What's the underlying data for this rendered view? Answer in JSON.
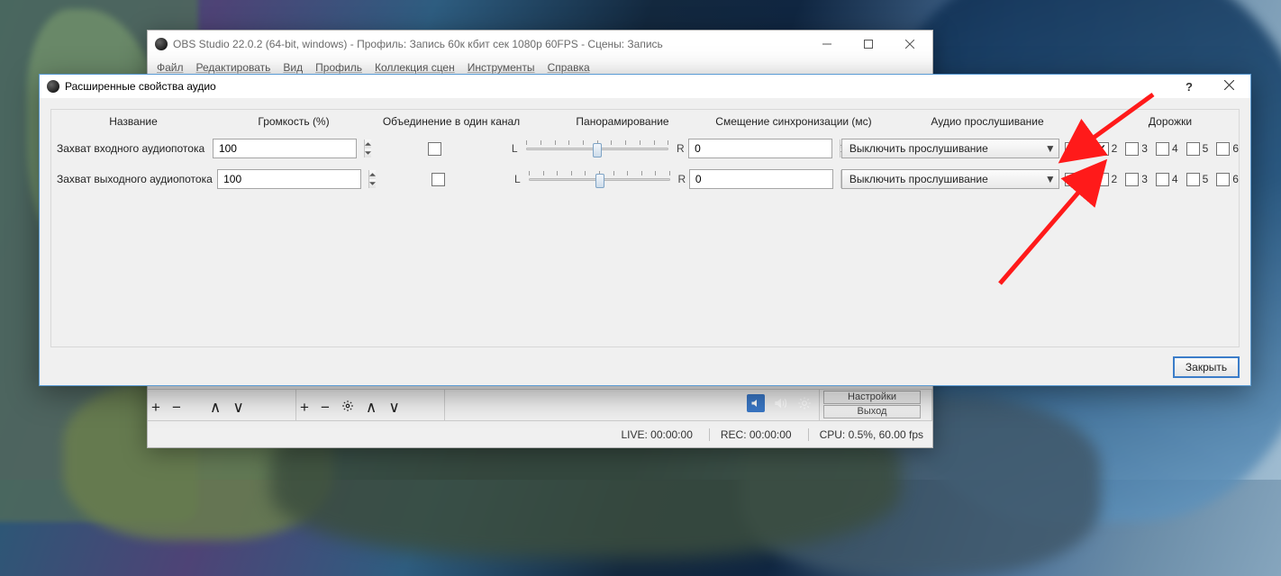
{
  "obs": {
    "title": "OBS Studio 22.0.2 (64-bit, windows) - Профиль: Запись 60к кбит сек 1080p 60FPS - Сцены: Запись",
    "menu": {
      "file": "Файл",
      "edit": "Редактировать",
      "view": "Вид",
      "profile": "Профиль",
      "sceneCollection": "Коллекция сцен",
      "tools": "Инструменты",
      "help": "Справка"
    },
    "status": {
      "live": "LIVE: 00:00:00",
      "rec": "REC: 00:00:00",
      "cpu": "CPU: 0.5%, 60.00 fps"
    },
    "controls": {
      "hiddenTop": "Настройки",
      "exit": "Выход"
    }
  },
  "dialog": {
    "title": "Расширенные свойства аудио",
    "closeBtn": "Закрыть",
    "headers": {
      "name": "Название",
      "volume": "Громкость (%)",
      "mono": "Объединение в один канал",
      "pan": "Панорамирование",
      "sync": "Смещение синхронизации (мс)",
      "monitor": "Аудио прослушивание",
      "tracks": "Дорожки"
    },
    "panLabels": {
      "l": "L",
      "r": "R"
    },
    "trackLabels": [
      "1",
      "2",
      "3",
      "4",
      "5",
      "6"
    ],
    "rows": [
      {
        "name": "Захват входного аудиопотока",
        "volume": "100",
        "mono": false,
        "sync": "0",
        "monitor": "Выключить прослушивание",
        "tracks": [
          false,
          true,
          false,
          false,
          false,
          false
        ]
      },
      {
        "name": "Захват выходного аудиопотока",
        "volume": "100",
        "mono": false,
        "sync": "0",
        "monitor": "Выключить прослушивание",
        "tracks": [
          true,
          false,
          false,
          false,
          false,
          false
        ]
      }
    ]
  }
}
